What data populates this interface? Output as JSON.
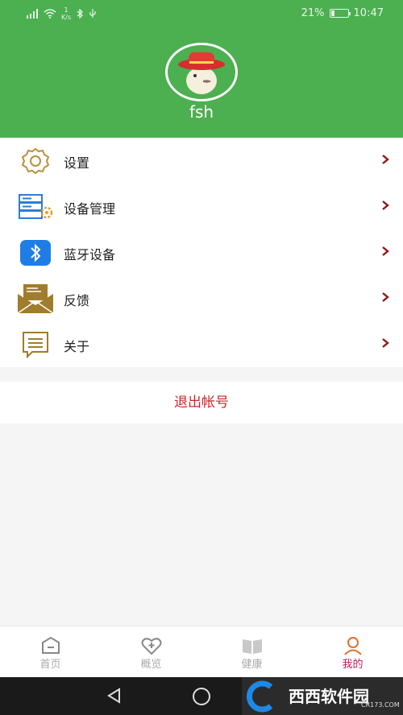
{
  "status_bar": {
    "speed_top": "1",
    "speed_unit": "K/s",
    "battery": "21%",
    "battery_level": 0.21,
    "time": "10:47"
  },
  "profile": {
    "username": "fsh"
  },
  "menu": {
    "items": [
      {
        "label": "设置",
        "icon": "gear-icon"
      },
      {
        "label": "设备管理",
        "icon": "device-manage-icon"
      },
      {
        "label": "蓝牙设备",
        "icon": "bluetooth-icon"
      },
      {
        "label": "反馈",
        "icon": "envelope-icon"
      },
      {
        "label": "关于",
        "icon": "message-icon"
      }
    ]
  },
  "logout_label": "退出帐号",
  "tabs": [
    {
      "label": "首页",
      "icon": "home-icon"
    },
    {
      "label": "概览",
      "icon": "heart-plus-icon"
    },
    {
      "label": "健康",
      "icon": "book-icon"
    },
    {
      "label": "我的",
      "icon": "user-icon",
      "active": true
    }
  ],
  "watermark": {
    "text": "西西软件园",
    "sub": "CR173.COM"
  },
  "colors": {
    "header": "#4caf50",
    "accent": "#c2185b",
    "logout": "#c62828",
    "arrow": "#8b1a1a"
  }
}
